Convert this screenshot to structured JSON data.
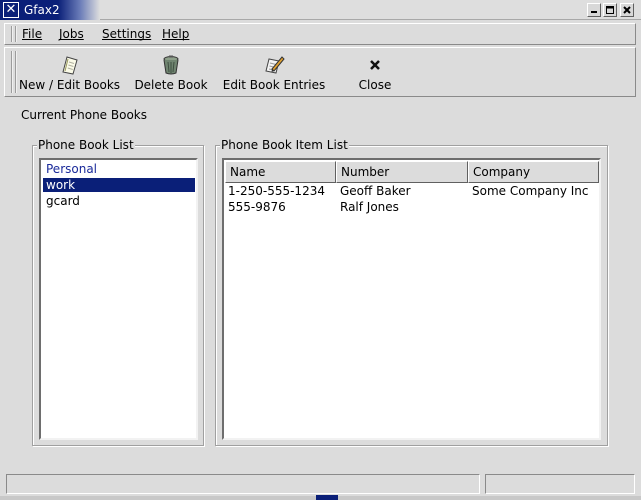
{
  "window": {
    "title": "Gfax2",
    "menu_glyph": "✕",
    "title_bar_color": "#0a1f78"
  },
  "menu": {
    "items": [
      {
        "label": "File"
      },
      {
        "label": "Jobs"
      },
      {
        "label": "Settings"
      },
      {
        "label": "Help"
      }
    ]
  },
  "toolbar": {
    "buttons": [
      {
        "label": "New / Edit Books",
        "icon": "notepad-icon"
      },
      {
        "label": "Delete Book",
        "icon": "trash-can-icon"
      },
      {
        "label": "Edit Book Entries",
        "icon": "edit-pencil-icon"
      },
      {
        "label": "Close",
        "icon": "close-x-icon"
      }
    ]
  },
  "main": {
    "section_label": "Current Phone Books",
    "phone_book_list": {
      "title": "Phone Book List",
      "items": [
        {
          "label": "Personal",
          "state": "focused"
        },
        {
          "label": "work",
          "state": "selected"
        },
        {
          "label": "gcard",
          "state": "normal"
        }
      ]
    },
    "item_list": {
      "title": "Phone Book Item List",
      "columns": [
        "Name",
        "Number",
        "Company"
      ],
      "rows": [
        [
          "1-250-555-1234",
          "Geoff Baker",
          "Some Company Inc"
        ],
        [
          "555-9876",
          "Ralf Jones",
          ""
        ]
      ]
    }
  },
  "statusbar": {
    "left": "",
    "right": ""
  },
  "colors": {
    "selection": "#0a1f78",
    "focused_text": "#1a2a9a",
    "background": "#dcdcdc"
  }
}
